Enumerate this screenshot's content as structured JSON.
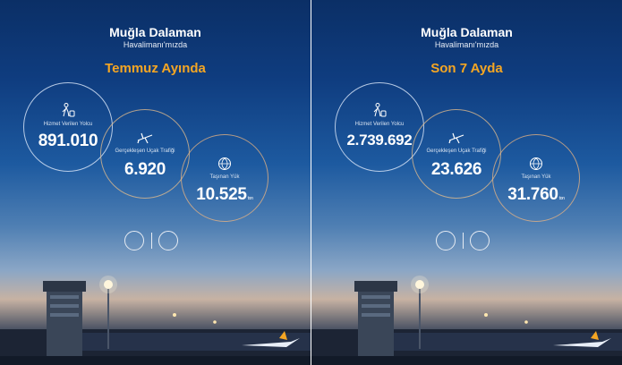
{
  "panels": [
    {
      "title": "Muğla Dalaman",
      "subtitle": "Havalimanı'mızda",
      "headline": "Temmuz Ayında",
      "stats": [
        {
          "label": "Hizmet Verilen Yolcu",
          "value": "891.010",
          "icon": "passenger-luggage-icon"
        },
        {
          "label": "Gerçekleşen Uçak Trafiği",
          "value": "6.920",
          "icon": "airplane-icon"
        },
        {
          "label": "Taşınan Yük",
          "value": "10.525",
          "unit": "ton",
          "icon": "cargo-globe-icon"
        }
      ]
    },
    {
      "title": "Muğla Dalaman",
      "subtitle": "Havalimanı'mızda",
      "headline": "Son 7 Ayda",
      "stats": [
        {
          "label": "Hizmet Verilen Yolcu",
          "value": "2.739.692",
          "icon": "passenger-luggage-icon"
        },
        {
          "label": "Gerçekleşen Uçak Trafiği",
          "value": "23.626",
          "icon": "airplane-icon"
        },
        {
          "label": "Taşınan Yük",
          "value": "31.760",
          "unit": "ton",
          "icon": "cargo-globe-icon"
        }
      ]
    }
  ],
  "colors": {
    "accent": "#f5a623",
    "sky_top": "#0b2f66",
    "sky_bottom": "#c7b2a3"
  }
}
